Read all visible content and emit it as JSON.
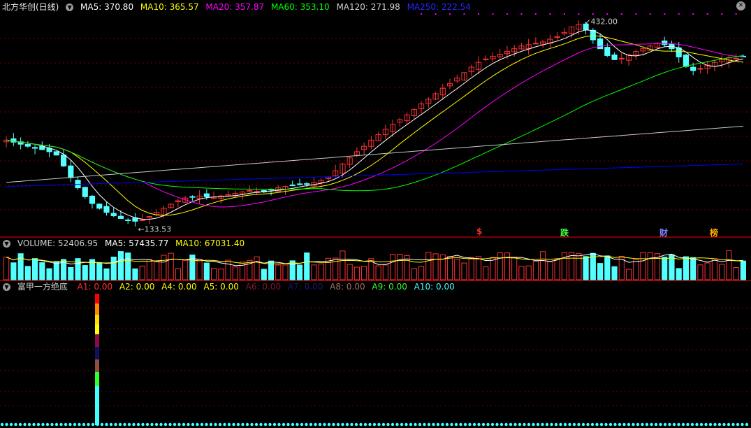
{
  "colors": {
    "up": "#ff3232",
    "down": "#54ffff",
    "ma5": "#ffffff",
    "ma10": "#ffff00",
    "ma20": "#ff00ff",
    "ma60": "#00ff00",
    "ma120": "#c8c8c8",
    "ma250": "#0000ff",
    "grid": "#7a0000",
    "separator": "#ff0000"
  },
  "header": {
    "stock": "北方华创(日线)",
    "ma5": "MA5: 370.80",
    "ma10": "MA10: 365.57",
    "ma20": "MA20: 357.87",
    "ma60": "MA60: 353.10",
    "ma120": "MA120: 271.98",
    "ma250": "MA250: 222.54"
  },
  "volume_header": {
    "label": "VOLUME: 52406.95",
    "ma5": "MA5: 57435.77",
    "ma10": "MA10: 67031.40"
  },
  "indicator_header": {
    "name": "富甲一方绝底",
    "a1": "A1: 0.00",
    "a2": "A2: 0.00",
    "a4": "A4: 0.00",
    "a5": "A5: 0.00",
    "a6": "A6: 0.00",
    "a7": "A7: 0.00",
    "a8": "A8: 0.00",
    "a9": "A9: 0.00",
    "a10": "A10: 0.00"
  },
  "annotations": {
    "high": "432.00",
    "low": "133.53",
    "tag_s": "$",
    "tag_die": "跌",
    "tag_cai": "财",
    "tag_bang": "榜"
  },
  "icons": {
    "collapse": "chevron-down-icon",
    "close": "close-icon"
  },
  "chart_data": {
    "type": "candlestick",
    "bars": 104,
    "price_range": [
      125,
      445
    ],
    "price_high": 432.0,
    "price_low": 133.53,
    "closes": [
      258,
      255,
      252,
      249,
      246,
      244,
      241,
      236,
      220,
      203,
      188,
      175,
      165,
      158,
      152,
      147,
      143,
      140,
      139,
      141,
      146,
      152,
      158,
      164,
      169,
      173,
      175,
      176,
      175,
      174,
      176,
      178,
      180,
      182,
      184,
      183,
      182,
      185,
      188,
      190,
      191,
      193,
      194,
      196,
      199,
      204,
      213,
      223,
      232,
      241,
      249,
      258,
      266,
      274,
      281,
      288,
      295,
      303,
      311,
      318,
      326,
      334,
      341,
      349,
      357,
      365,
      372,
      377,
      381,
      384,
      388,
      392,
      396,
      398,
      400,
      402,
      406,
      410,
      416,
      424,
      428,
      420,
      405,
      392,
      382,
      376,
      378,
      383,
      388,
      392,
      396,
      400,
      398,
      392,
      380,
      366,
      360,
      363,
      368,
      372,
      376,
      379,
      378,
      381
    ],
    "volume_label": "VOLUME",
    "volume_last": 52406.95,
    "volume_ma5_last": 57435.77,
    "volume_ma10_last": 67031.4
  }
}
